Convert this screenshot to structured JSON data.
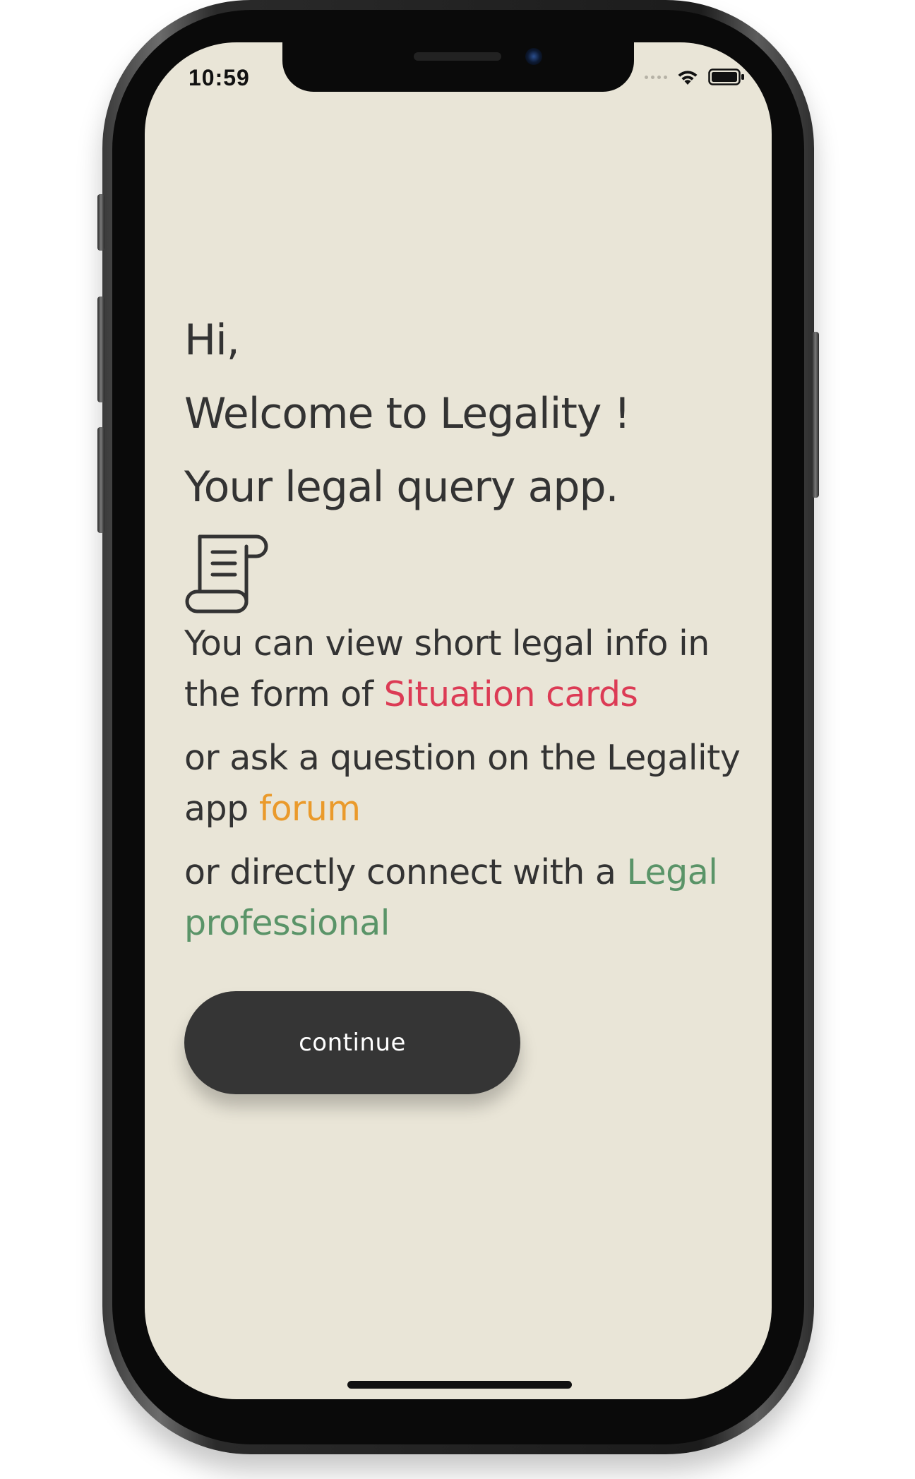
{
  "status_bar": {
    "time": "10:59",
    "icons": [
      "cellular-signal-icon",
      "wifi-icon",
      "battery-icon"
    ]
  },
  "welcome": {
    "line1": "Hi,",
    "line2": "Welcome to Legality !",
    "line3": "Your legal query app."
  },
  "icon": {
    "name": "legal-scroll-icon"
  },
  "info": {
    "p1_text": "You can view short legal info in the form of ",
    "p1_link": "Situation cards",
    "p2_text": "or ask a question on the Legality app ",
    "p2_link": "forum",
    "p3_text": "or directly connect with a ",
    "p3_link": "Legal professional"
  },
  "colors": {
    "background": "#e9e5d7",
    "text": "#333333",
    "situation_cards": "#dc3b55",
    "forum": "#ea9a2b",
    "legal_professional": "#5a9468",
    "button": "#353535"
  },
  "actions": {
    "continue_label": "continue"
  }
}
